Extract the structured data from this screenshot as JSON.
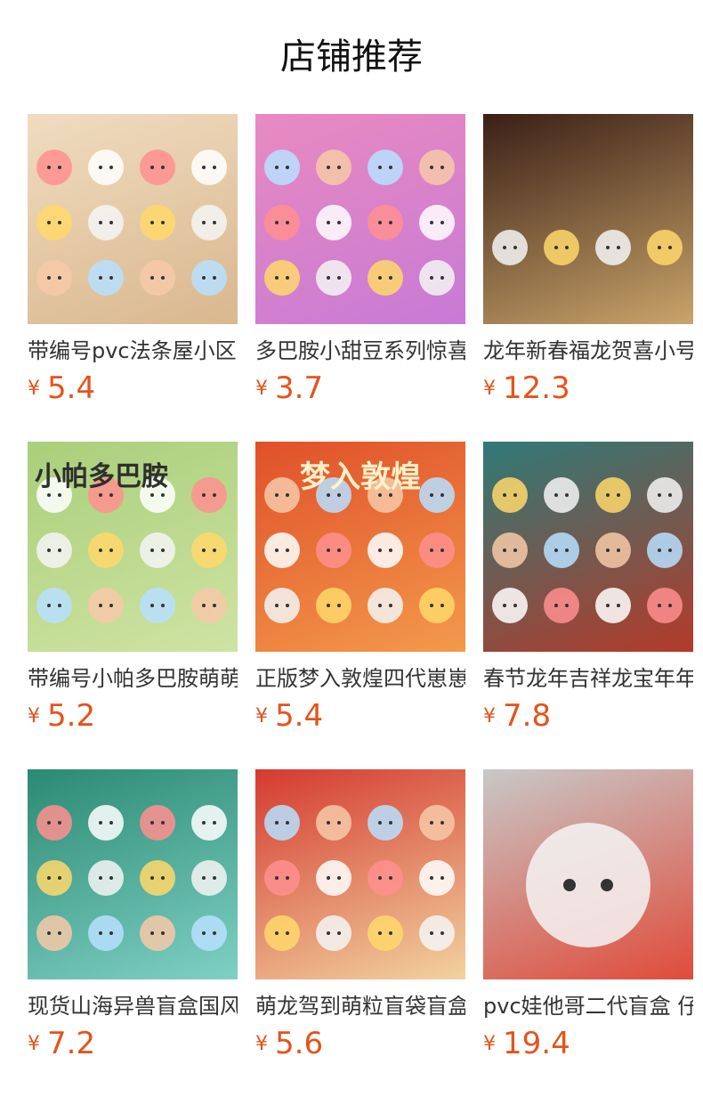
{
  "header": {
    "title": "店铺推荐"
  },
  "currency_symbol": "¥",
  "products": [
    {
      "name": "带编号pvc法条屋小区",
      "price": "5.4",
      "image": "figure-group-on-stands",
      "colors": [
        "#f0dcc0",
        "#d9b78e"
      ]
    },
    {
      "name": "多巴胺小甜豆系列惊喜",
      "price": "3.7",
      "image": "colorful-doll-row",
      "colors": [
        "#e98ac0",
        "#c77ad6"
      ]
    },
    {
      "name": "龙年新春福龙贺喜小号",
      "price": "12.3",
      "image": "lion-dance-dragon-dolls",
      "colors": [
        "#3a1f16",
        "#c9a46a"
      ]
    },
    {
      "name": "带编号小帕多巴胺萌萌",
      "price": "5.2",
      "image": "pochacco-collection",
      "colors": [
        "#a9cf7a",
        "#cfe3a4"
      ]
    },
    {
      "name": "正版梦入敦煌四代崽崽",
      "price": "5.4",
      "image": "dunhuang-blind-box",
      "colors": [
        "#e0502a",
        "#f39a4b"
      ]
    },
    {
      "name": "春节龙年吉祥龙宝年年",
      "price": "7.8",
      "image": "dragon-baby-lion-dance",
      "colors": [
        "#2f7a78",
        "#b43a2a"
      ]
    },
    {
      "name": "现货山海异兽盲盒国风",
      "price": "7.2",
      "image": "mythical-beast-figures",
      "colors": [
        "#2b8a73",
        "#7fd0c4"
      ]
    },
    {
      "name": "萌龙驾到萌粒盲袋盲盒",
      "price": "5.6",
      "image": "cute-dragon-display",
      "colors": [
        "#d43a2f",
        "#f2d2a0"
      ]
    },
    {
      "name": "pvc娃他哥二代盲盒 仔",
      "price": "19.4",
      "image": "fox-hood-figure",
      "colors": [
        "#c8c8c8",
        "#e04b3a"
      ]
    }
  ],
  "image_captions": {
    "dunhuang_title": "梦入敦煌",
    "pochacco_title": "小帕多巴胺"
  }
}
